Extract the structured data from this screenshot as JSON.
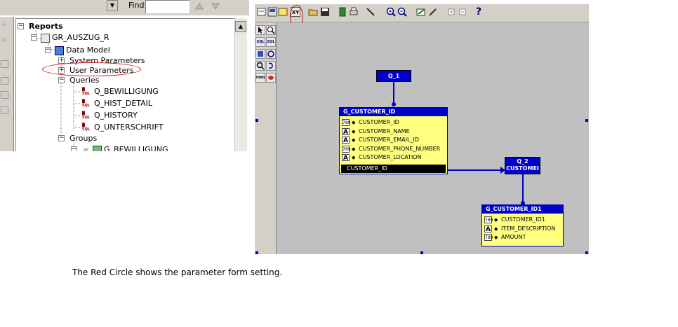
{
  "navigator": {
    "find_label": "Find:",
    "find_value": "",
    "tree": [
      {
        "id": "reports",
        "label": "Reports"
      },
      {
        "id": "report",
        "label": "GR_AUSZUG_R"
      },
      {
        "id": "data-model",
        "label": "Data Model"
      },
      {
        "id": "system-parameters",
        "label": "System Parameters"
      },
      {
        "id": "user-parameters",
        "label": "User Parameters"
      },
      {
        "id": "queries",
        "label": "Queries"
      },
      {
        "id": "q-bewilligung",
        "label": "Q_BEWILLIGUNG"
      },
      {
        "id": "q-hist-detail",
        "label": "Q_HIST_DETAIL"
      },
      {
        "id": "q-history",
        "label": "Q_HISTORY"
      },
      {
        "id": "q-unterschrift",
        "label": "Q_UNTERSCHRIFT"
      },
      {
        "id": "groups",
        "label": "Groups"
      },
      {
        "id": "g-bewilligung",
        "label": "G_BEWILLIGUNG"
      }
    ]
  },
  "designer": {
    "toolbar_icons": [
      "open-report-icon",
      "group-icon",
      "field-icon",
      "xy-parameter-form-icon",
      "open-folder-icon",
      "save-icon",
      "run-icon",
      "print-icon",
      "cut-icon",
      "zoom-in-icon",
      "zoom-out-icon",
      "report-wizard-icon",
      "edit-icon",
      "expand-icon",
      "collapse-icon",
      "help-icon"
    ],
    "help_glyph": "?",
    "xy_glyph": "XY",
    "palette_icons": [
      "select-icon",
      "magnify-icon",
      "sql-query-icon",
      "ref-cursor-icon",
      "summary-icon",
      "formula-icon",
      "link-icon",
      "cross-product-icon",
      "placeholder-icon",
      "data-link-icon"
    ],
    "palette_labels": {
      "sql": "SQL",
      "sql2": "SQL",
      "hmb": "hmb"
    },
    "query1": {
      "name": "Q_1"
    },
    "query2": {
      "name": "Q_2",
      "subtitle": "CUSTOMEI"
    },
    "group1": {
      "title": "G_CUSTOMER_ID",
      "columns": [
        {
          "type": "789",
          "name": "CUSTOMER_ID"
        },
        {
          "type": "A",
          "name": "CUSTOMER_NAME"
        },
        {
          "type": "A",
          "name": "CUSTOMER_EMAIL_ID"
        },
        {
          "type": "789",
          "name": "CUSTOMER_PHONE_NUMBER"
        },
        {
          "type": "A",
          "name": "CUSTOMER_LOCATION"
        }
      ],
      "link_column": "CUSTOMER_ID"
    },
    "group2": {
      "title": "G_CUSTOMER_ID1",
      "columns": [
        {
          "type": "789",
          "name": "CUSTOMER_ID1"
        },
        {
          "type": "A",
          "name": "ITEM_DESCRIPTION"
        },
        {
          "type": "789",
          "name": "AMOUNT"
        }
      ]
    },
    "colors": {
      "query_fill": "#0000cc",
      "group_fill": "#ffff80",
      "highlight_circle": "#d01010",
      "canvas": "#c0c0c0"
    }
  },
  "caption": "The Red Circle shows the parameter form setting."
}
